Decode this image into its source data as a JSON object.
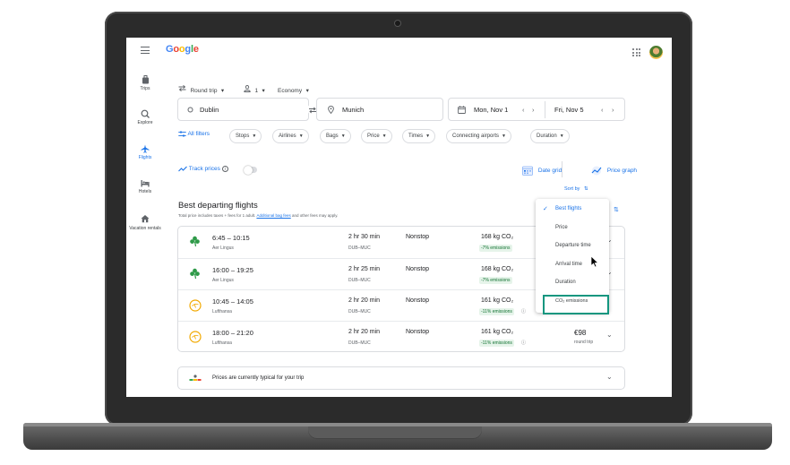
{
  "app": {
    "logo_text": "Google",
    "brand_colors": [
      "#4285f4",
      "#ea4335",
      "#fbbc05",
      "#34a853"
    ],
    "accent": "#1a73e8",
    "highlight_color": "#13967f"
  },
  "sidebar": {
    "items": [
      {
        "label": "Trips",
        "icon": "suitcase-icon",
        "active": false
      },
      {
        "label": "Explore",
        "icon": "explore-icon",
        "active": false
      },
      {
        "label": "Flights",
        "icon": "plane-icon",
        "active": true
      },
      {
        "label": "Hotels",
        "icon": "bed-icon",
        "active": false
      },
      {
        "label": "Vacation rentals",
        "icon": "home-icon",
        "active": false
      }
    ]
  },
  "search": {
    "trip_type": "Round trip",
    "passengers": "1",
    "cabin": "Economy",
    "origin": "Dublin",
    "destination": "Munich",
    "depart_date": "Mon, Nov 1",
    "return_date": "Fri, Nov 5"
  },
  "filters": {
    "all_filters": "All filters",
    "chips": [
      "Stops",
      "Airlines",
      "Bags",
      "Price",
      "Times",
      "Connecting airports",
      "Duration"
    ]
  },
  "tools": {
    "track_prices": "Track prices",
    "date_grid": "Date grid",
    "price_graph": "Price graph",
    "sort_by": "Sort by"
  },
  "results": {
    "heading": "Best departing flights",
    "note_prefix": "Total price includes taxes + fees for 1 adult. ",
    "note_link": "Additional bag fees",
    "note_suffix": " and other fees may apply.",
    "flights": [
      {
        "times": "6:45 – 10:15",
        "airline": "Aer Lingus",
        "logo": "shamrock-icon",
        "duration": "2 hr 30 min",
        "route": "DUB–MUC",
        "stops": "Nonstop",
        "co2": "168 kg CO₂",
        "emissions": "-7% emissions",
        "price": "",
        "price_type": ""
      },
      {
        "times": "16:00 – 19:25",
        "airline": "Aer Lingus",
        "logo": "shamrock-icon",
        "duration": "2 hr 25 min",
        "route": "DUB–MUC",
        "stops": "Nonstop",
        "co2": "168 kg CO₂",
        "emissions": "-7% emissions",
        "price": "",
        "price_type": ""
      },
      {
        "times": "10:45 – 14:05",
        "airline": "Lufthansa",
        "logo": "crane-icon",
        "duration": "2 hr 20 min",
        "route": "DUB–MUC",
        "stops": "Nonstop",
        "co2": "161 kg CO₂",
        "emissions": "-11% emissions",
        "price": "",
        "price_type": ""
      },
      {
        "times": "18:00 – 21:20",
        "airline": "Lufthansa",
        "logo": "crane-icon",
        "duration": "2 hr 20 min",
        "route": "DUB–MUC",
        "stops": "Nonstop",
        "co2": "161 kg CO₂",
        "emissions": "-11% emissions",
        "price": "€98",
        "price_type": "round trip"
      }
    ]
  },
  "banner": {
    "text": "Prices are currently typical for your trip"
  },
  "sort_menu": {
    "options": [
      "Best flights",
      "Price",
      "Departure time",
      "Arrival time",
      "Duration",
      "CO₂ emissions"
    ],
    "selected": "Best flights",
    "highlighted": "CO₂ emissions"
  }
}
